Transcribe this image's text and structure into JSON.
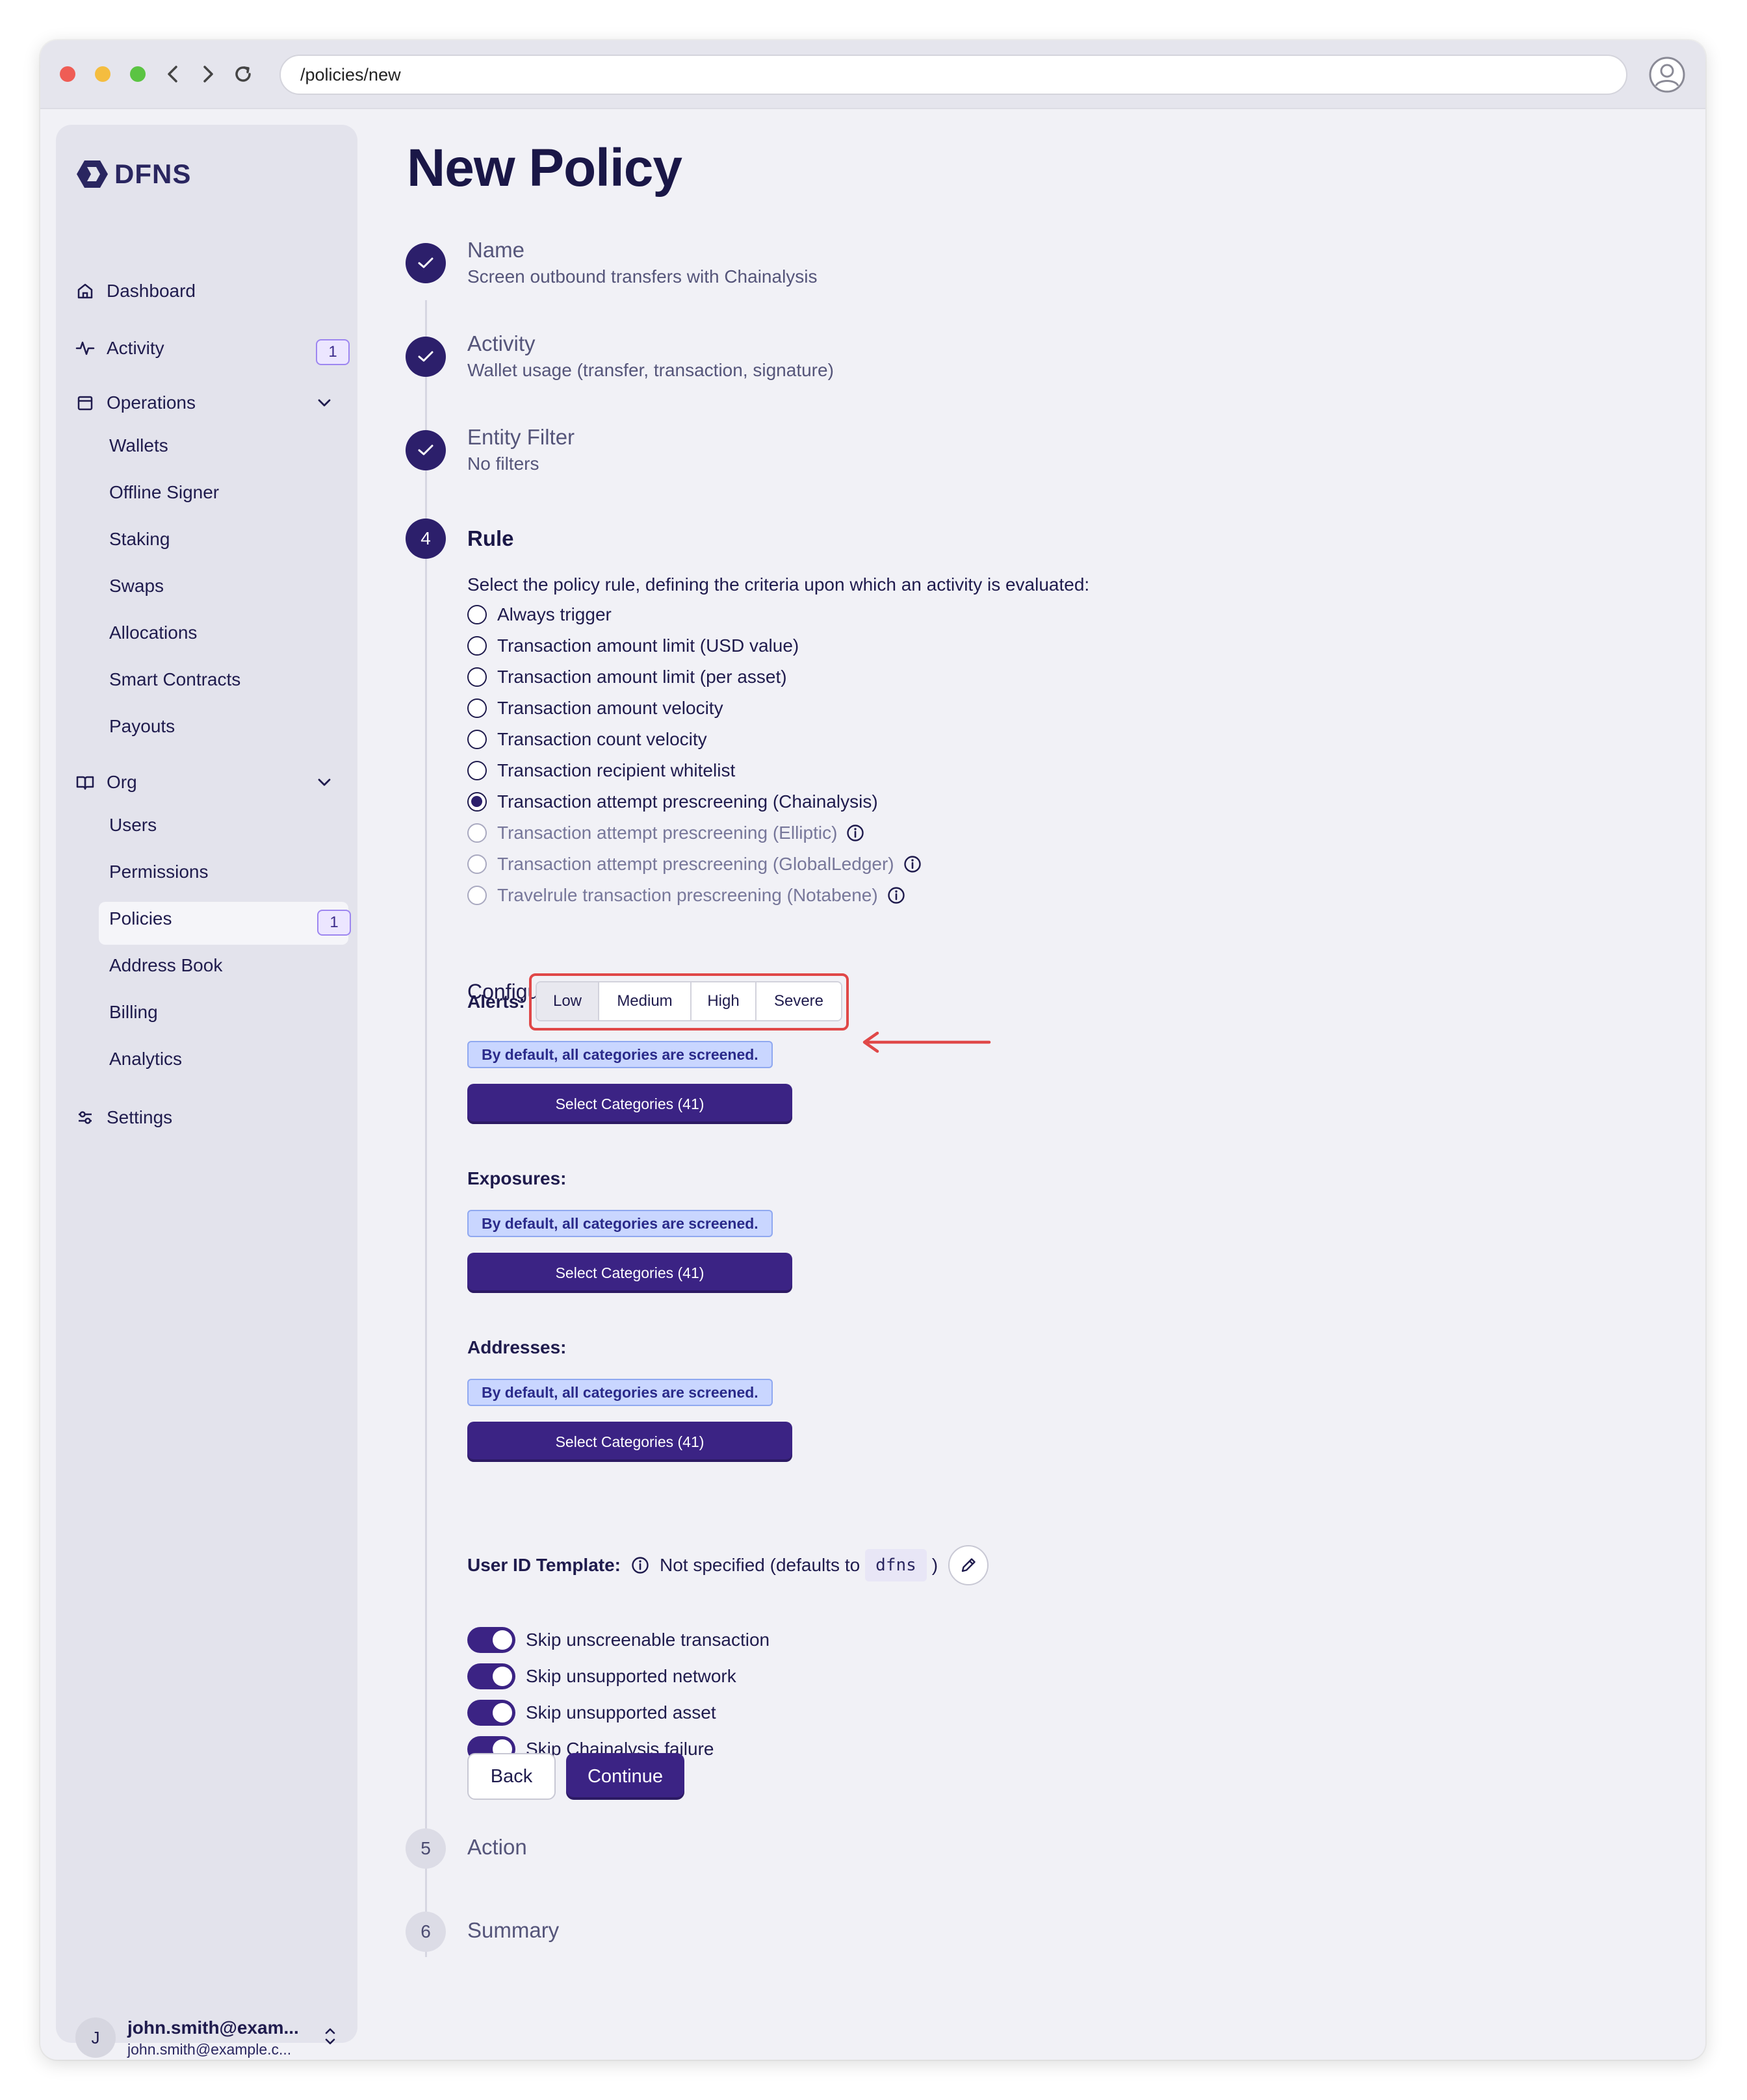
{
  "browser": {
    "url": "/policies/new"
  },
  "sidebar": {
    "logo": "DFNS",
    "items": {
      "dashboard": "Dashboard",
      "activity": "Activity",
      "activity_badge": "1",
      "operations": "Operations",
      "org": "Org",
      "settings": "Settings"
    },
    "operations_items": [
      "Wallets",
      "Offline Signer",
      "Staking",
      "Swaps",
      "Allocations",
      "Smart Contracts",
      "Payouts"
    ],
    "org_items": [
      "Users",
      "Permissions",
      "Policies",
      "Address Book",
      "Billing",
      "Analytics"
    ],
    "policies_badge": "1",
    "user": {
      "initial": "J",
      "name": "john.smith@exam...",
      "email": "john.smith@example.c..."
    }
  },
  "page": {
    "title": "New Policy",
    "steps": [
      {
        "num": "",
        "title": "Name",
        "summary": "Screen outbound transfers with Chainalysis"
      },
      {
        "num": "",
        "title": "Activity",
        "summary": "Wallet usage (transfer, transaction, signature)"
      },
      {
        "num": "",
        "title": "Entity Filter",
        "summary": "No filters"
      },
      {
        "num": "4",
        "title": "Rule",
        "summary": ""
      },
      {
        "num": "5",
        "title": "Action",
        "summary": ""
      },
      {
        "num": "6",
        "title": "Summary",
        "summary": ""
      }
    ],
    "rule": {
      "intro": "Select the policy rule, defining the criteria upon which an activity is evaluated:",
      "options": [
        "Always trigger",
        "Transaction amount limit (USD value)",
        "Transaction amount limit (per asset)",
        "Transaction amount velocity",
        "Transaction count velocity",
        "Transaction recipient whitelist",
        "Transaction attempt prescreening (Chainalysis)",
        "Transaction attempt prescreening (Elliptic)",
        "Transaction attempt prescreening (GlobalLedger)",
        "Travelrule transaction prescreening (Notabene)"
      ],
      "selected": "Transaction attempt prescreening (Chainalysis)"
    },
    "config": {
      "title": "Configuration:",
      "alerts_label": "Alerts:",
      "alert_levels": [
        "Low",
        "Medium",
        "High",
        "Severe"
      ],
      "alert_selected": "Low",
      "default_note": "By default, all categories are screened.",
      "select_button": "Select Categories (41)",
      "exposures_label": "Exposures:",
      "addresses_label": "Addresses:",
      "user_id_label": "User ID Template:",
      "user_id_text": "Not specified (defaults to",
      "user_id_default": "dfns",
      "user_id_close": ")",
      "toggles": [
        "Skip unscreenable transaction",
        "Skip unsupported network",
        "Skip unsupported asset",
        "Skip Chainalysis failure"
      ]
    },
    "buttons": {
      "back": "Back",
      "continue": "Continue"
    }
  },
  "colors": {
    "accent": "#3b2384",
    "step_done": "#2c1f6b",
    "annotation": "#e04848",
    "info_pill": "#c9d6ff"
  }
}
